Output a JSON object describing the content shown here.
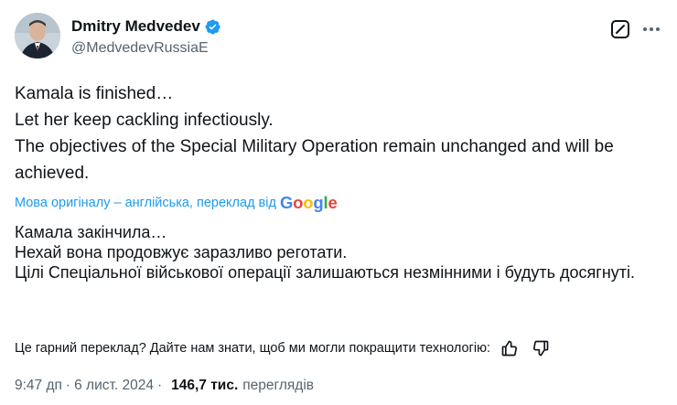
{
  "author": {
    "display_name": "Dmitry Medvedev",
    "handle": "@MedvedevRussiaE",
    "verified_icon": "verified-badge-icon",
    "avatar_icon": "avatar-photo"
  },
  "tweet": {
    "lines": [
      "Kamala is finished…",
      "Let her keep cackling infectiously.",
      "The objectives of the Special Military Operation remain unchanged and will be achieved."
    ]
  },
  "translation": {
    "note": "Мова оригіналу – англійська, переклад від",
    "provider_logo": "Google",
    "lines": [
      "Камала закінчила…",
      "Нехай вона продовжує заразливо реготати.",
      "Цілі Спеціальної військової операції залишаються незмінними і будуть досягнуті."
    ],
    "feedback_prompt": "Це гарний переклад? Дайте нам знати, щоб ми могли покращити технологію:"
  },
  "meta": {
    "time": "9:47 дп",
    "separator": "·",
    "date": "6 лист. 2024",
    "views_count": "146,7 тис.",
    "views_label": "переглядів"
  },
  "colors": {
    "link": "#1d9bf0",
    "secondary": "#536471",
    "verified": "#1d9bf0"
  }
}
